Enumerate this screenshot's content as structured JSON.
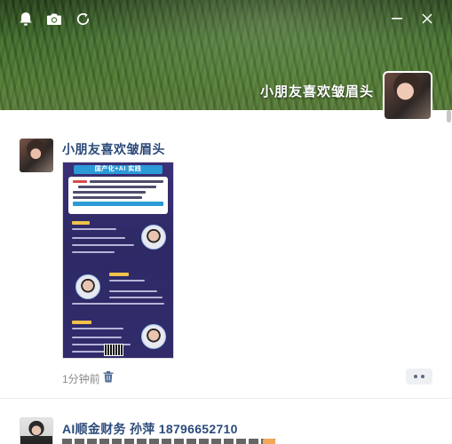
{
  "header": {
    "profile_name": "小朋友喜欢皱眉头",
    "icons": [
      "bell-icon",
      "camera-icon",
      "refresh-icon"
    ],
    "window_controls": [
      "minimize-icon",
      "close-icon"
    ]
  },
  "posts": [
    {
      "author": "小朋友喜欢皱眉头",
      "time": "1分钟前",
      "image": {
        "banner": "国产化+AI 实践"
      }
    },
    {
      "author": "AI顺金财务 孙萍 18796652710"
    }
  ],
  "colors": {
    "author_name": "#2c4a7a",
    "timestamp": "#8a8a8a",
    "poster_background": "#312b6b",
    "poster_banner": "#2d9ad8"
  }
}
